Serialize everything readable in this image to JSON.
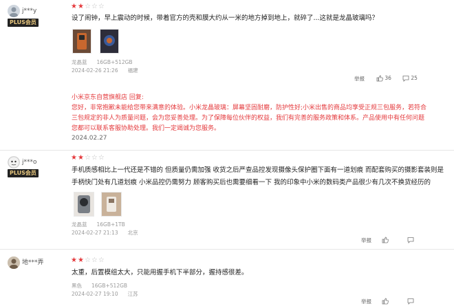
{
  "colors": {
    "star_on": "#e4393c",
    "reply_text": "#e4393c",
    "plus_badge_bg": "#222222",
    "plus_badge_text": "#e8c77e"
  },
  "reviews": [
    {
      "username": "j***y",
      "badge": "PLUS会员",
      "rating": 2,
      "rating_max": 5,
      "content": "设了闹钟，早上震动的时候，带着官方的壳和膜大约从一米的地方掉到地上，就碎了...这就是龙晶玻璃吗？",
      "images": [
        "phone-photo-1",
        "phone-photo-2"
      ],
      "color": "龙晶蓝",
      "spec": "16GB+512GB",
      "date": "2024-02-26 21:26",
      "location": "福建",
      "report_label": "举报",
      "likes": "36",
      "comments": "25",
      "seller_reply": {
        "title": "小米京东自营旗舰店 回复:",
        "lines": [
          "您好，非常抱歉未能给您带来满意的体验。小米龙晶玻璃：屏幕坚固耐磨，防护性好;小米出售的商品均享受正规三包服务，若符合",
          "三包规定的非人为质量问题，会为您妥善处理。为了保障每位伙伴的权益，我们有完善的服务政策和体系。产品使用中有任何问题",
          "您都可以联系客服协助处理。我们一定竭诚为您服务。"
        ],
        "date": "2024.02.27"
      }
    },
    {
      "username": "j***o",
      "badge": "PLUS会员",
      "rating": 2,
      "rating_max": 5,
      "content_lines": [
        "手机质感相比上一代还是不错的 但质量仍需加强 收货之后严查品控发现摄像头保护圈下面有一道划痕 而配套购买的摄影套装则是",
        "手柄快门处有几道划痕 小米品控仍需努力 顾客购买后也需要细看一下 我的印象中小米的数码类产品很少有几次不换货经历的"
      ],
      "images": [
        "camera-photo",
        "grip-photo"
      ],
      "color": "龙晶蓝",
      "spec": "16GB+1TB",
      "date": "2024-02-27 21:13",
      "location": "北京",
      "report_label": "举报",
      "likes": "",
      "comments": ""
    },
    {
      "username": "地***弄",
      "rating": 2,
      "rating_max": 5,
      "content": "太重，后置模组太大，只能用握手机下半部分，握持感很差。",
      "color": "黑色",
      "spec": "16GB+512GB",
      "date": "2024-02-27 19:10",
      "location": "江苏",
      "report_label": "举报",
      "likes": "",
      "comments": ""
    }
  ]
}
